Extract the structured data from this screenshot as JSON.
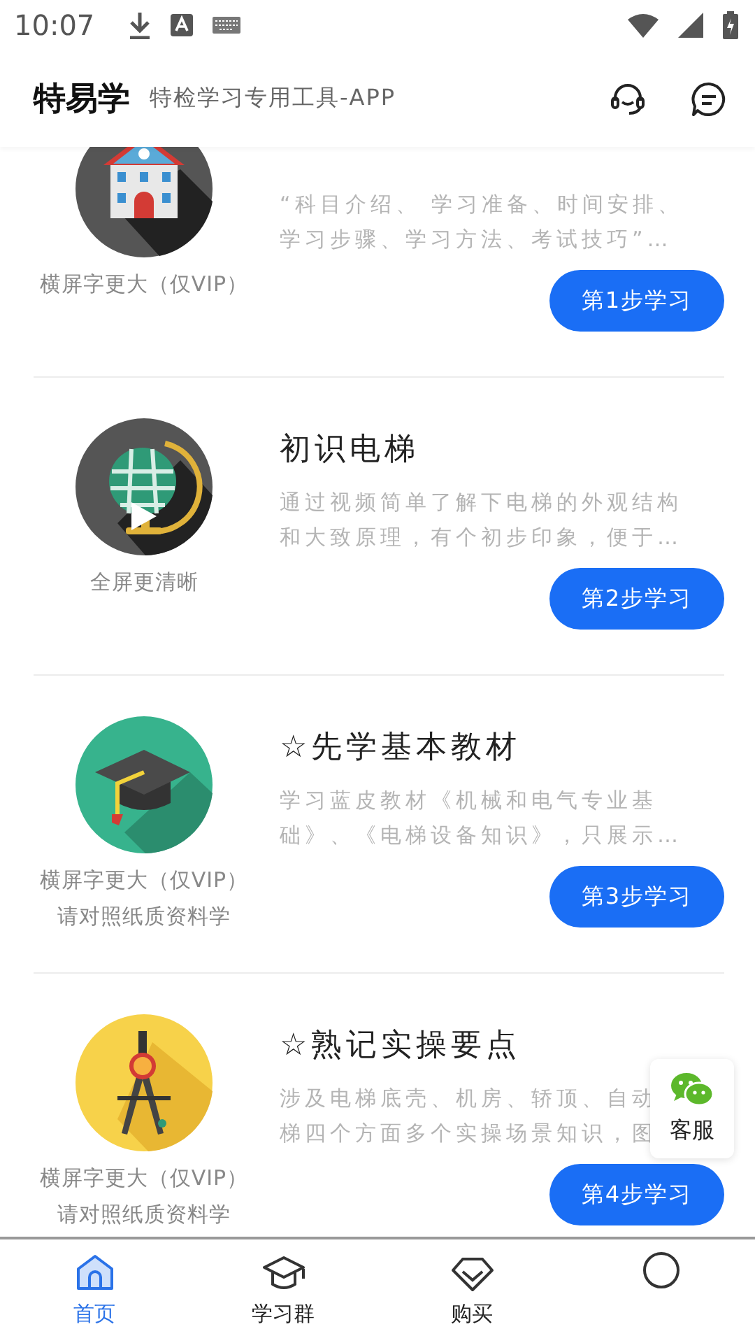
{
  "status_bar": {
    "time": "10:07"
  },
  "header": {
    "title": "特易学",
    "subtitle": "特检学习专用工具-APP"
  },
  "lessons": [
    {
      "kind": "building",
      "desc_lines": [
        "“科目介绍、 学习准备、时间安排、",
        "学习步骤、学习方法、考试技巧”…"
      ],
      "captions": [
        "横屏字更大（仅VIP）"
      ],
      "button": "第1步学习"
    },
    {
      "kind": "globe",
      "title": "初识电梯",
      "desc_lines": [
        "通过视频简单了解下电梯的外观结构",
        "和大致原理，有个初步印象，便于…"
      ],
      "captions": [
        "全屏更清晰"
      ],
      "button": "第2步学习"
    },
    {
      "kind": "cap",
      "title": "☆先学基本教材",
      "desc_lines": [
        "学习蓝皮教材《机械和电气专业基",
        "础》、《电梯设备知识》，只展示…"
      ],
      "captions": [
        "横屏字更大（仅VIP）",
        "请对照纸质资料学"
      ],
      "button": "第3步学习"
    },
    {
      "kind": "compass",
      "title": "☆熟记实操要点",
      "desc_lines": [
        "涉及电梯底壳、机房、轿顶、自动",
        "梯四个方面多个实操场景知识，图"
      ],
      "captions": [
        "横屏字更大（仅VIP）",
        "请对照纸质资料学"
      ],
      "button": "第4步学习"
    }
  ],
  "service": {
    "label": "客服"
  },
  "tabs": [
    {
      "kind": "home",
      "label": "首页",
      "selected": true
    },
    {
      "kind": "cap",
      "label": "学习群",
      "selected": false
    },
    {
      "kind": "gem",
      "label": "购买",
      "selected": false
    },
    {
      "kind": "person",
      "selected": false
    }
  ]
}
